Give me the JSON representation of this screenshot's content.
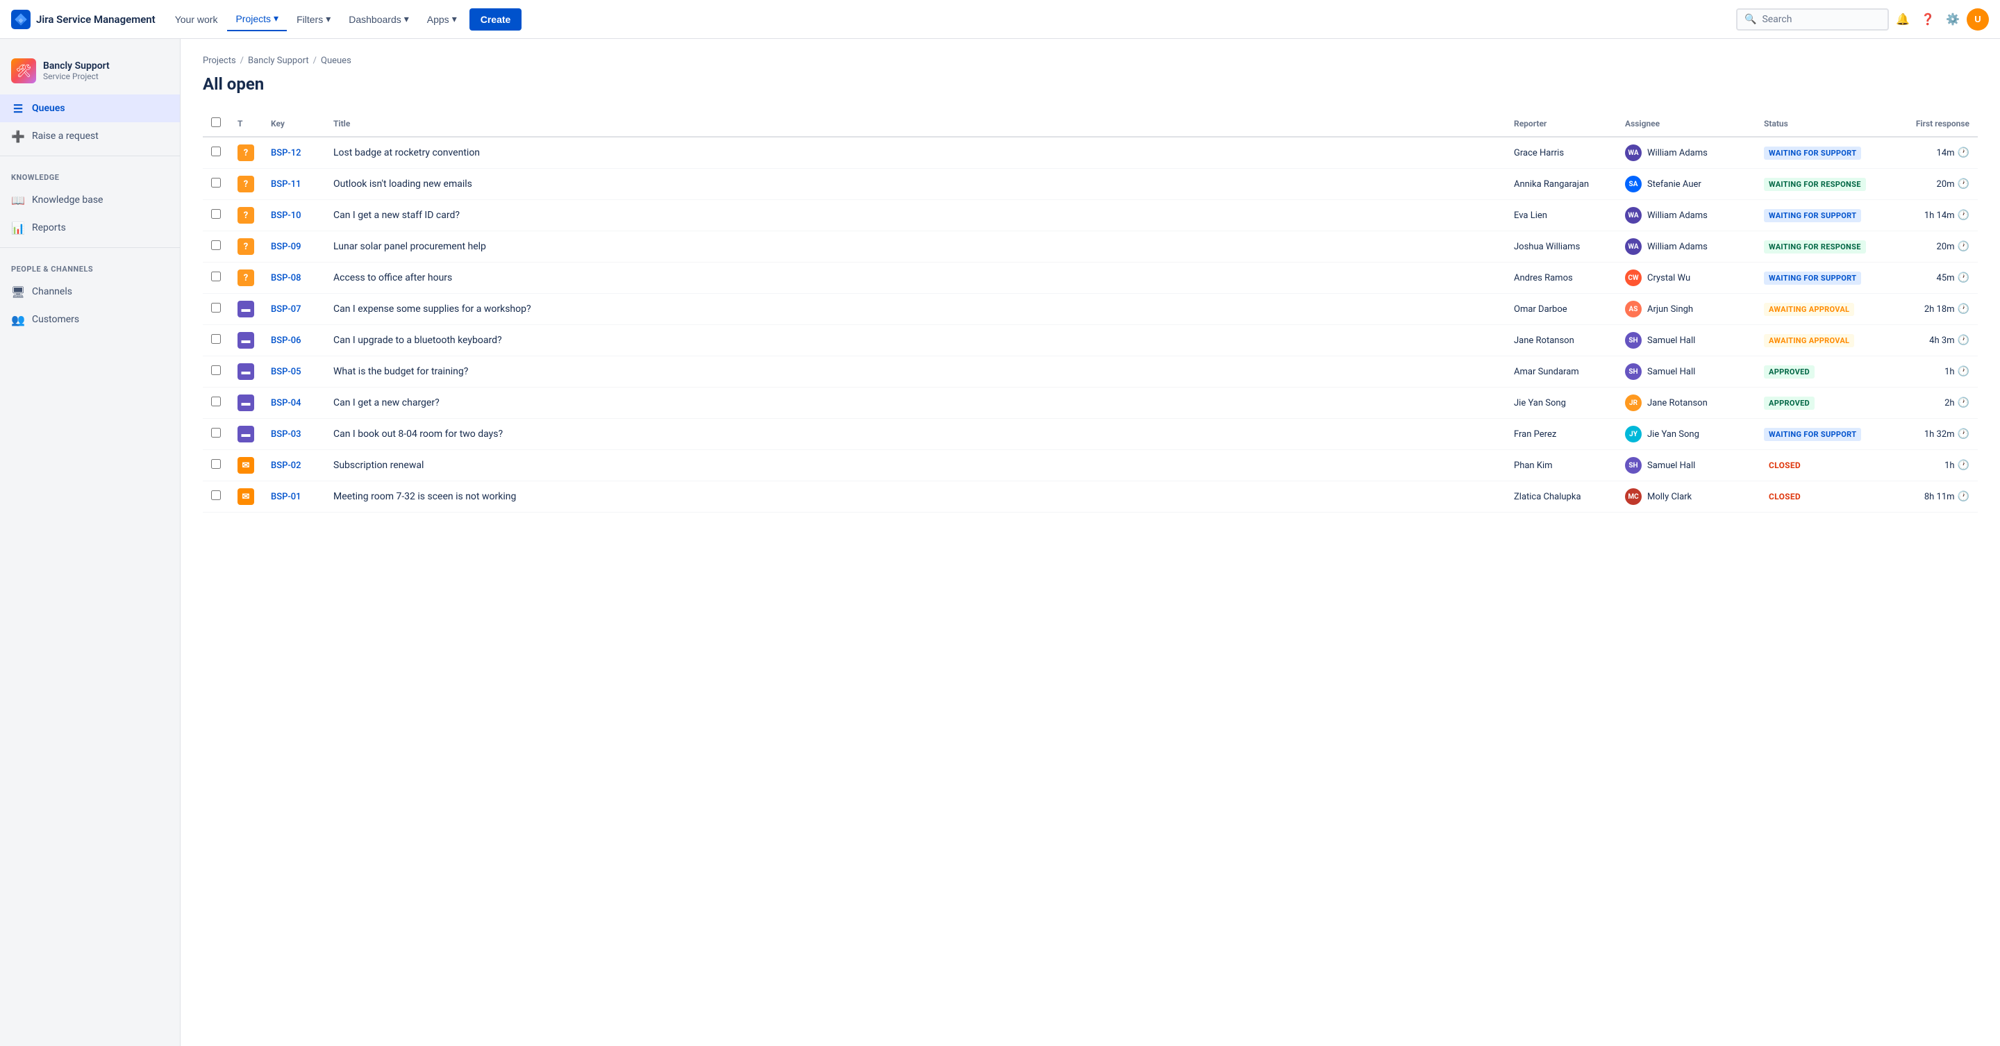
{
  "topnav": {
    "logo_text": "Jira Service Management",
    "nav_items": [
      {
        "label": "Your work",
        "active": false
      },
      {
        "label": "Projects",
        "active": true,
        "has_dropdown": true
      },
      {
        "label": "Filters",
        "active": false,
        "has_dropdown": true
      },
      {
        "label": "Dashboards",
        "active": false,
        "has_dropdown": true
      },
      {
        "label": "Apps",
        "active": false,
        "has_dropdown": true
      }
    ],
    "create_label": "Create",
    "search_placeholder": "Search"
  },
  "sidebar": {
    "project_name": "Bancly Support",
    "project_type": "Service Project",
    "nav_items": [
      {
        "label": "Queues",
        "active": true,
        "icon": "queues"
      },
      {
        "label": "Raise a request",
        "active": false,
        "icon": "raise"
      }
    ],
    "sections": [
      {
        "label": "KNOWLEDGE",
        "items": [
          {
            "label": "Knowledge base",
            "icon": "kb"
          },
          {
            "label": "Reports",
            "icon": "reports"
          }
        ]
      },
      {
        "label": "PEOPLE & CHANNELS",
        "items": [
          {
            "label": "Channels",
            "icon": "channels"
          },
          {
            "label": "Customers",
            "icon": "customers"
          }
        ]
      }
    ]
  },
  "breadcrumb": [
    {
      "label": "Projects",
      "href": "#"
    },
    {
      "label": "Bancly Support",
      "href": "#"
    },
    {
      "label": "Queues",
      "href": "#"
    }
  ],
  "page_title": "All open",
  "table": {
    "columns": [
      "",
      "T",
      "Key",
      "Title",
      "Reporter",
      "Assignee",
      "Status",
      "First response"
    ],
    "rows": [
      {
        "key": "BSP-12",
        "type": "question",
        "title": "Lost badge at rocketry convention",
        "reporter": "Grace Harris",
        "assignee": "William Adams",
        "assignee_initials": "WA",
        "assignee_class": "av-wa",
        "status": "WAITING FOR SUPPORT",
        "status_class": "status-waiting-support",
        "first_response": "14m"
      },
      {
        "key": "BSP-11",
        "type": "question",
        "title": "Outlook isn't loading new emails",
        "reporter": "Annika Rangarajan",
        "assignee": "Stefanie Auer",
        "assignee_initials": "SA",
        "assignee_class": "av-sa",
        "status": "WAITING FOR RESPONSE",
        "status_class": "status-waiting-response",
        "first_response": "20m"
      },
      {
        "key": "BSP-10",
        "type": "question",
        "title": "Can I get a new staff ID card?",
        "reporter": "Eva Lien",
        "assignee": "William Adams",
        "assignee_initials": "WA",
        "assignee_class": "av-wa",
        "status": "WAITING FOR SUPPORT",
        "status_class": "status-waiting-support",
        "first_response": "1h 14m"
      },
      {
        "key": "BSP-09",
        "type": "question",
        "title": "Lunar solar panel procurement help",
        "reporter": "Joshua Williams",
        "assignee": "William Adams",
        "assignee_initials": "WA",
        "assignee_class": "av-wa",
        "status": "WAITING FOR RESPONSE",
        "status_class": "status-waiting-response",
        "first_response": "20m"
      },
      {
        "key": "BSP-08",
        "type": "question",
        "title": "Access to office after hours",
        "reporter": "Andres Ramos",
        "assignee": "Crystal Wu",
        "assignee_initials": "CW",
        "assignee_class": "av-cr",
        "status": "WAITING FOR SUPPORT",
        "status_class": "status-waiting-support",
        "first_response": "45m"
      },
      {
        "key": "BSP-07",
        "type": "task",
        "title": "Can I expense some supplies for a workshop?",
        "reporter": "Omar Darboe",
        "assignee": "Arjun Singh",
        "assignee_initials": "AS",
        "assignee_class": "av-ar",
        "status": "AWAITING APPROVAL",
        "status_class": "status-awaiting-approval",
        "first_response": "2h 18m"
      },
      {
        "key": "BSP-06",
        "type": "task",
        "title": "Can I upgrade to a bluetooth keyboard?",
        "reporter": "Jane Rotanson",
        "assignee": "Samuel Hall",
        "assignee_initials": "SH",
        "assignee_class": "av-sh",
        "status": "AWAITING APPROVAL",
        "status_class": "status-awaiting-approval",
        "first_response": "4h 3m"
      },
      {
        "key": "BSP-05",
        "type": "task",
        "title": "What is the budget for training?",
        "reporter": "Amar Sundaram",
        "assignee": "Samuel Hall",
        "assignee_initials": "SH",
        "assignee_class": "av-sh",
        "status": "APPROVED",
        "status_class": "status-approved",
        "first_response": "1h"
      },
      {
        "key": "BSP-04",
        "type": "task",
        "title": "Can I get a new charger?",
        "reporter": "Jie Yan Song",
        "assignee": "Jane Rotanson",
        "assignee_initials": "JR",
        "assignee_class": "av-jr",
        "status": "APPROVED",
        "status_class": "status-approved",
        "first_response": "2h"
      },
      {
        "key": "BSP-03",
        "type": "task",
        "title": "Can I book out 8-04 room for two days?",
        "reporter": "Fran Perez",
        "assignee": "Jie Yan Song",
        "assignee_initials": "JY",
        "assignee_class": "av-jy",
        "status": "WAITING FOR SUPPORT",
        "status_class": "status-waiting-support",
        "first_response": "1h 32m"
      },
      {
        "key": "BSP-02",
        "type": "email",
        "title": "Subscription renewal",
        "reporter": "Phan Kim",
        "assignee": "Samuel Hall",
        "assignee_initials": "SH",
        "assignee_class": "av-sh",
        "status": "CLOSED",
        "status_class": "status-closed",
        "first_response": "1h"
      },
      {
        "key": "BSP-01",
        "type": "email",
        "title": "Meeting room 7-32 is sceen is not working",
        "reporter": "Zlatica Chalupka",
        "assignee": "Molly Clark",
        "assignee_initials": "MC",
        "assignee_class": "av-mo",
        "status": "CLOSED",
        "status_class": "status-closed",
        "first_response": "8h 11m"
      }
    ]
  }
}
